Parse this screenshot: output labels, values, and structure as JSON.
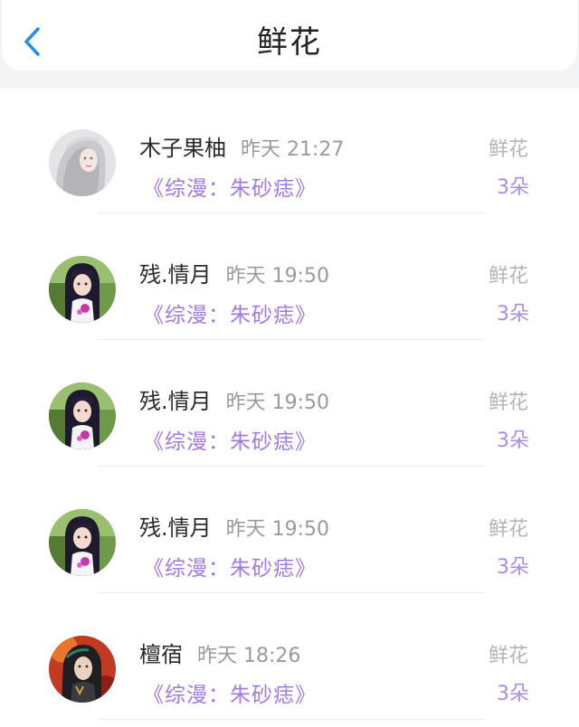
{
  "header": {
    "title": "鲜花",
    "back_icon": "chevron-left-icon",
    "accent": "#2b8fe8"
  },
  "items": [
    {
      "name": "木子果柚",
      "time": "昨天 21:27",
      "book": "《综漫：朱砂痣》",
      "gift": "鲜花",
      "count": "3朵",
      "avatar": "avatar-silver-hair"
    },
    {
      "name": "残.情月",
      "time": "昨天 19:50",
      "book": "《综漫：朱砂痣》",
      "gift": "鲜花",
      "count": "3朵",
      "avatar": "avatar-dark-hair-girl"
    },
    {
      "name": "残.情月",
      "time": "昨天 19:50",
      "book": "《综漫：朱砂痣》",
      "gift": "鲜花",
      "count": "3朵",
      "avatar": "avatar-dark-hair-girl"
    },
    {
      "name": "残.情月",
      "time": "昨天 19:50",
      "book": "《综漫：朱砂痣》",
      "gift": "鲜花",
      "count": "3朵",
      "avatar": "avatar-dark-hair-girl"
    },
    {
      "name": "檀宿",
      "time": "昨天 18:26",
      "book": "《综漫：朱砂痣》",
      "gift": "鲜花",
      "count": "3朵",
      "avatar": "avatar-red-anime"
    }
  ],
  "colors": {
    "book_title": "#a07ae0",
    "count": "#a98de8",
    "gift_label": "#b5b5b5"
  }
}
